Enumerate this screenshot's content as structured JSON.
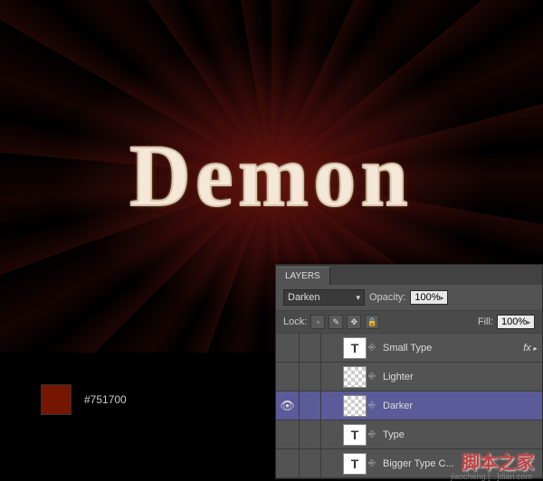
{
  "main_text": "Demon",
  "swatch": {
    "color": "#751700",
    "label": "#751700"
  },
  "panel": {
    "tab": "LAYERS",
    "blend_mode": "Darken",
    "opacity_label": "Opacity:",
    "opacity_value": "100%",
    "lock_label": "Lock:",
    "fill_label": "Fill:",
    "fill_value": "100%"
  },
  "lock_icons": [
    "▫",
    "✎",
    "✥",
    "🔒"
  ],
  "layers": [
    {
      "name": "Small Type",
      "visible": false,
      "active": false,
      "thumb": "txt",
      "linked": true,
      "fx": true
    },
    {
      "name": "Lighter",
      "visible": false,
      "active": false,
      "thumb": "trans",
      "linked": true,
      "fx": false
    },
    {
      "name": "Darker",
      "visible": true,
      "active": true,
      "thumb": "trans",
      "linked": true,
      "fx": false
    },
    {
      "name": "Type",
      "visible": false,
      "active": false,
      "thumb": "txt",
      "linked": true,
      "fx": false
    },
    {
      "name": "Bigger Type C...",
      "visible": false,
      "active": false,
      "thumb": "txt",
      "linked": true,
      "fx": false
    }
  ],
  "watermark": {
    "main": "脚本之家",
    "sub": "jiaocheng.[...]dian.com"
  }
}
